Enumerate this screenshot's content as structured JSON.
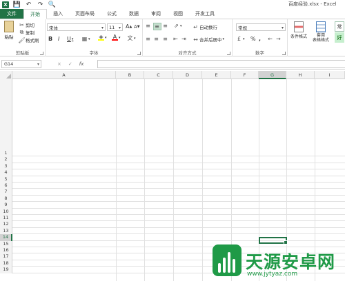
{
  "title_bar": {
    "logo": "X",
    "doc_title": "百度经验.xlsx - Excel",
    "quick_access": [
      "save-icon",
      "undo-icon",
      "redo-icon",
      "print-preview-icon"
    ]
  },
  "tabs": [
    {
      "label": "文件",
      "kind": "file"
    },
    {
      "label": "开始",
      "kind": "active"
    },
    {
      "label": "插入",
      "kind": ""
    },
    {
      "label": "页面布局",
      "kind": ""
    },
    {
      "label": "公式",
      "kind": ""
    },
    {
      "label": "数据",
      "kind": ""
    },
    {
      "label": "审阅",
      "kind": ""
    },
    {
      "label": "视图",
      "kind": ""
    },
    {
      "label": "开发工具",
      "kind": ""
    }
  ],
  "ribbon": {
    "clipboard": {
      "label": "剪贴板",
      "paste": "粘贴",
      "cut": "剪切",
      "copy": "复制",
      "format_painter": "格式刷"
    },
    "font": {
      "label": "字体",
      "font_name": "宋体",
      "font_size": "11",
      "grow": "A",
      "shrink": "A",
      "bold": "B",
      "italic": "I",
      "underline": "U",
      "font_color": "A",
      "phonetic": "文"
    },
    "alignment": {
      "label": "对齐方式",
      "wrap_text": "自动换行",
      "merge_center": "合并后居中"
    },
    "number": {
      "label": "数字",
      "format": "常规",
      "percent": "%",
      "comma": ","
    },
    "styles": {
      "conditional_format": "条件格式",
      "format_as_table": "套用\n表格格式",
      "cell_style_preview": "常",
      "good": "好"
    }
  },
  "formula_bar": {
    "name_box": "G14",
    "fx": "fx",
    "cancel": "×",
    "enter": "✓",
    "value": ""
  },
  "grid": {
    "columns": [
      "A",
      "B",
      "C",
      "D",
      "E",
      "F",
      "G",
      "H",
      "I"
    ],
    "selected_column": "G",
    "rows": [
      "1",
      "2",
      "3",
      "4",
      "5",
      "6",
      "7",
      "8",
      "9",
      "10",
      "11",
      "12",
      "13",
      "14",
      "15",
      "16",
      "17",
      "18",
      "19"
    ],
    "selected_row": "14",
    "active_cell": "G14"
  },
  "watermark": {
    "title": "天源安卓网",
    "url": "www.jytyaz.com"
  },
  "colors": {
    "excel_green": "#217346",
    "watermark_green": "#1f9a47"
  }
}
